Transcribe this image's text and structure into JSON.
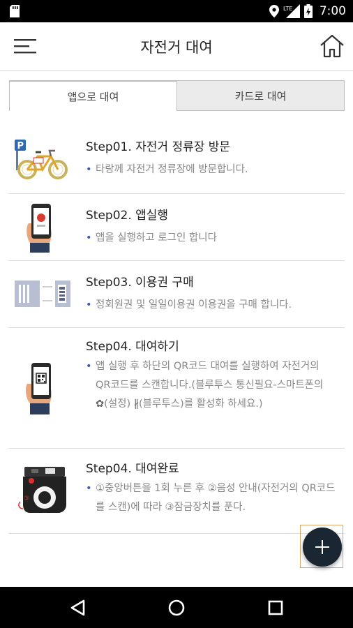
{
  "status_bar": {
    "time": "7:00",
    "network": "LTE"
  },
  "app_bar": {
    "title": "자전거 대여",
    "menu_icon": "hamburger-menu-icon",
    "home_icon": "home-icon"
  },
  "tabs": [
    {
      "label": "앱으로 대여",
      "selected": true
    },
    {
      "label": "카드로 대여",
      "selected": false
    }
  ],
  "steps": [
    {
      "title": "Step01. 자전거 정류장 방문",
      "desc": "타랑께 자전거 정류장에 방문합니다.",
      "image": "bicycle-station-image"
    },
    {
      "title": "Step02. 앱실행",
      "desc": "앱을 실행하고 로그인 합니다",
      "image": "phone-app-image"
    },
    {
      "title": "Step03. 이용권 구매",
      "desc": "정회원권 및 일일이용권 이용권을 구매 합니다.",
      "image": "ticket-image"
    },
    {
      "title": "Step04. 대여하기",
      "desc_parts": [
        "앱 실행 후 하단의 QR코드 대여를 실행하여 자전거의 QR코드를 스캔합니다.(블루투스 통신필요-스마트폰의 ",
        "(설정) ",
        "(블루투스)를 활성화 하세요.)"
      ],
      "image": "phone-qr-image"
    },
    {
      "title": "Step04. 대여완료",
      "desc": "①중앙버튼을 1회 누른 후 ②음성 안내(자전거의 QR코드를 스캔)에 따라 ③잠금장치를 푼다.",
      "image": "bike-lock-image"
    }
  ],
  "fab": {
    "icon": "plus-icon"
  },
  "colors": {
    "bullet": "#3a5ab0",
    "fab": "#1b2633",
    "tab_inactive": "#ebebeb"
  }
}
